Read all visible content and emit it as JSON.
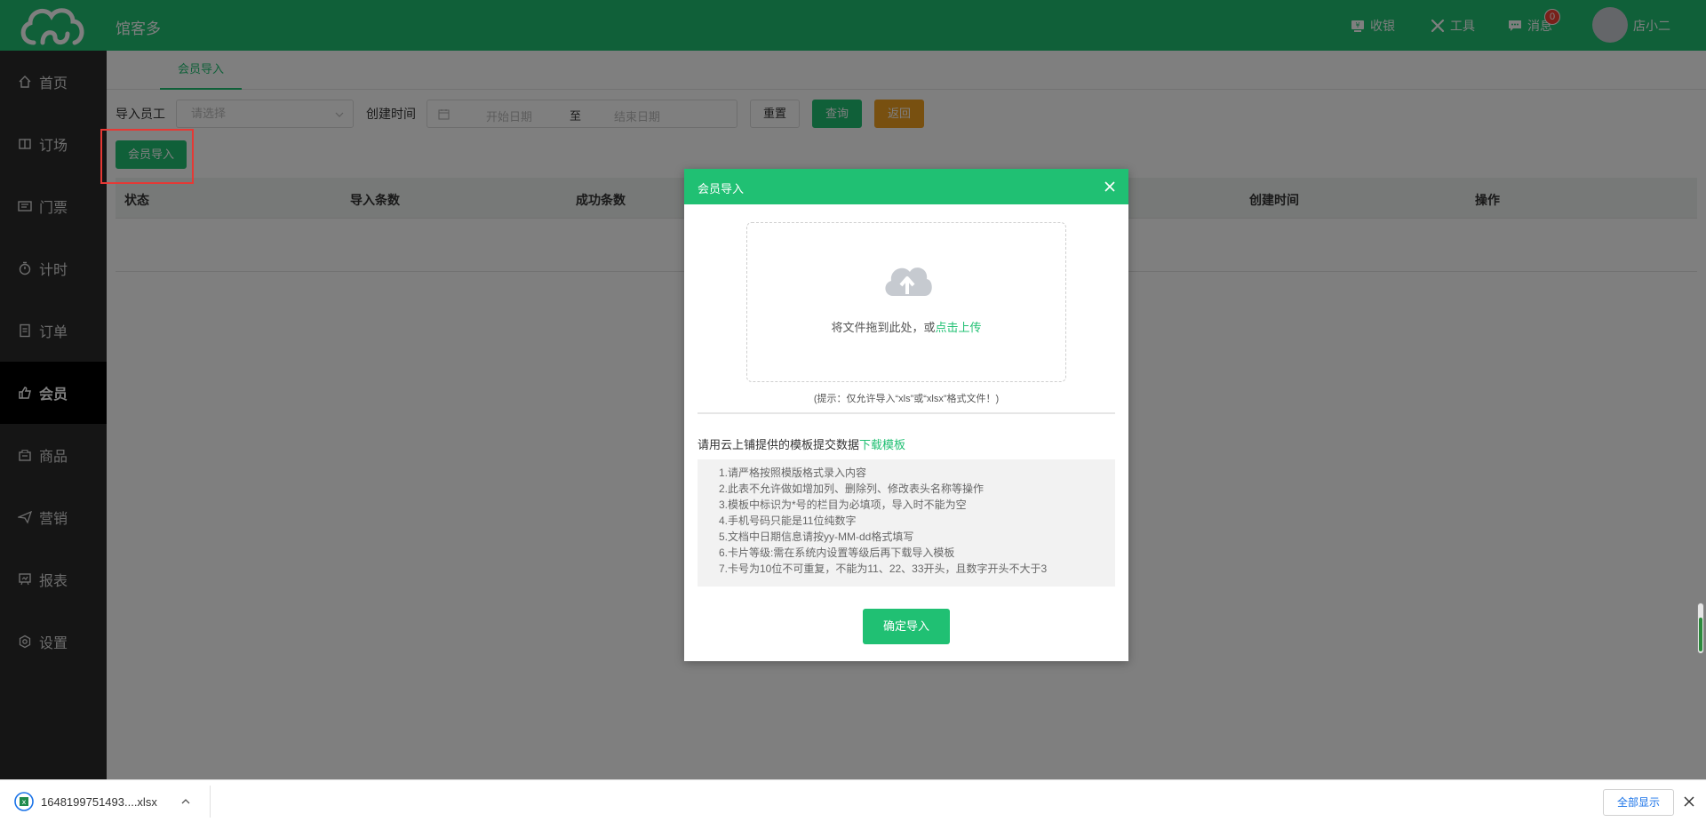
{
  "header": {
    "app_title": "馆客多",
    "items": [
      {
        "label": "收银",
        "icon": "cashier-icon"
      },
      {
        "label": "工具",
        "icon": "tools-icon"
      },
      {
        "label": "消息",
        "icon": "message-icon"
      }
    ],
    "message_badge": "0",
    "user_name": "店小二"
  },
  "sidebar": {
    "items": [
      {
        "label": "首页",
        "icon": "home-icon"
      },
      {
        "label": "订场",
        "icon": "venue-icon"
      },
      {
        "label": "门票",
        "icon": "ticket-icon"
      },
      {
        "label": "计时",
        "icon": "timer-icon"
      },
      {
        "label": "订单",
        "icon": "order-icon"
      },
      {
        "label": "会员",
        "icon": "member-icon",
        "active": true
      },
      {
        "label": "商品",
        "icon": "goods-icon"
      },
      {
        "label": "营销",
        "icon": "marketing-icon"
      },
      {
        "label": "报表",
        "icon": "report-icon"
      },
      {
        "label": "设置",
        "icon": "settings-icon"
      }
    ]
  },
  "page": {
    "tab": "会员导入",
    "filters": {
      "staff_label": "导入员工",
      "staff_placeholder": "请选择",
      "time_label": "创建时间",
      "start_placeholder": "开始日期",
      "range_sep": "至",
      "end_placeholder": "结束日期"
    },
    "buttons": {
      "reset": "重置",
      "query": "查询",
      "back": "返回",
      "import": "会员导入"
    },
    "table_columns": [
      "状态",
      "导入条数",
      "成功条数",
      "创建时间",
      "操作"
    ]
  },
  "modal": {
    "title": "会员导入",
    "drop_text": "将文件拖到此处，或",
    "drop_link": "点击上传",
    "tip": "(提示：仅允许导入“xls”或“xlsx”格式文件！)",
    "template_text": "请用云上铺提供的模板提交数据",
    "template_link": "下载模板",
    "rules": [
      "1.请严格按照模版格式录入内容",
      "2.此表不允许做如增加列、删除列、修改表头名称等操作",
      "3.模板中标识为*号的栏目为必填项，导入时不能为空",
      "4.手机号码只能是11位纯数字",
      "5.文档中日期信息请按yy-MM-dd格式填写",
      "6.卡片等级:需在系统内设置等级后再下载导入模板",
      "7.卡号为10位不可重复，不能为11、22、33开头，且数字开头不大于3"
    ],
    "confirm": "确定导入"
  },
  "download_bar": {
    "file_name": "1648199751493....xlsx",
    "show_all": "全部显示"
  },
  "colors": {
    "brand_green": "#20c073",
    "sidebar_bg": "#2b2b2b",
    "warning_orange": "#f0a020",
    "highlight_red": "#e53935"
  }
}
